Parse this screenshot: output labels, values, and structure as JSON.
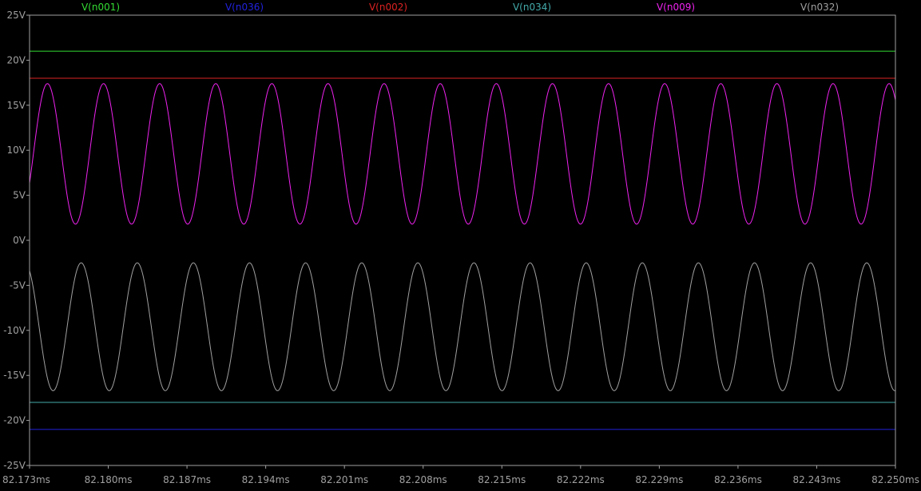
{
  "chart_data": {
    "type": "line",
    "title": "",
    "xlabel": "",
    "ylabel": "",
    "x_unit": "ms",
    "x_range": [
      82.173,
      82.25
    ],
    "x_ticks": [
      "82.173ms",
      "82.180ms",
      "82.187ms",
      "82.194ms",
      "82.201ms",
      "82.208ms",
      "82.215ms",
      "82.222ms",
      "82.229ms",
      "82.236ms",
      "82.243ms",
      "82.250ms"
    ],
    "x_tick_values": [
      82.173,
      82.18,
      82.187,
      82.194,
      82.201,
      82.208,
      82.215,
      82.222,
      82.229,
      82.236,
      82.243,
      82.25
    ],
    "ylim": [
      -25,
      25
    ],
    "y_ticks": [
      "25V",
      "20V",
      "15V",
      "10V",
      "5V",
      "0V",
      "-5V",
      "-10V",
      "-15V",
      "-20V",
      "-25V"
    ],
    "y_tick_values": [
      25,
      20,
      15,
      10,
      5,
      0,
      -5,
      -10,
      -15,
      -20,
      -25
    ],
    "grid": false,
    "legend_placement": "top",
    "background_color": "#000000",
    "axis_color": "#a0a0a0",
    "series": [
      {
        "name": "V(n001)",
        "color": "#33dd33",
        "kind": "dc",
        "value": 21.0
      },
      {
        "name": "V(n036)",
        "color": "#2222dd",
        "kind": "dc",
        "value": -21.0
      },
      {
        "name": "V(n002)",
        "color": "#dd2222",
        "kind": "dc",
        "value": 18.0
      },
      {
        "name": "V(n034)",
        "color": "#44aaaa",
        "kind": "dc",
        "value": -18.0
      },
      {
        "name": "V(n009)",
        "color": "#ee22ee",
        "kind": "sine",
        "offset": 9.6,
        "amplitude": 7.8,
        "period": 0.00499,
        "phase_time": 82.17459
      },
      {
        "name": "V(n032)",
        "color": "#a0a0a0",
        "kind": "sine",
        "offset": -9.6,
        "amplitude": 7.1,
        "period": 0.00499,
        "phase_time": 82.17759
      }
    ]
  }
}
